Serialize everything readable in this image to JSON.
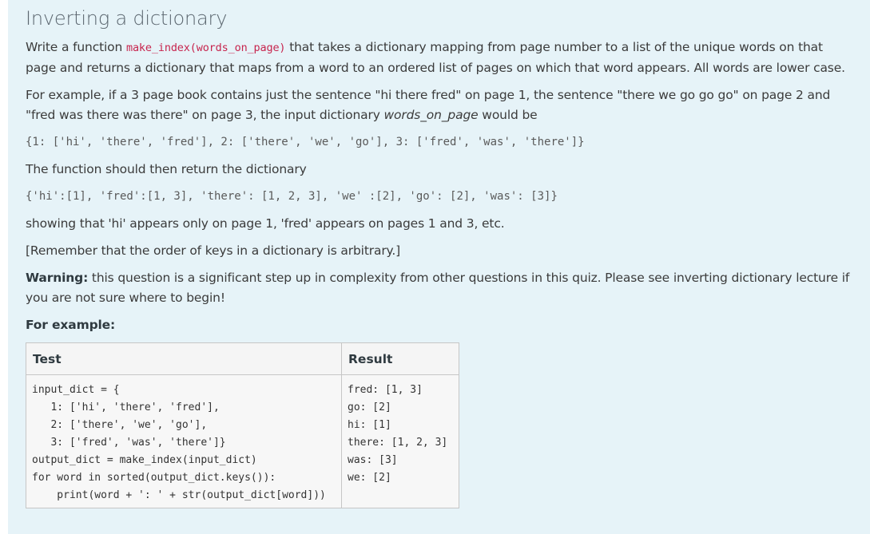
{
  "question": {
    "title": "Inverting a dictionary",
    "intro_before": "Write a function ",
    "function_signature": "make_index(words_on_page)",
    "intro_after": " that takes a dictionary mapping from page number to a list of the unique words on that page and returns a dictionary that maps from a word to an ordered list of pages on which that word appears. All words are lower case.",
    "example_text_before": "For example, if a 3 page book contains just the sentence \"hi there fred\" on page 1, the sentence \"there we go go go\" on page 2 and \"fred was there was there\" on page 3, the input dictionary ",
    "example_text_em": "words_on_page",
    "example_text_after": " would be",
    "input_dict_literal": "{1: ['hi', 'there', 'fred'], 2: ['there', 'we', 'go'], 3: ['fred', 'was', 'there']}",
    "return_text": "The function should then return the dictionary",
    "output_dict_literal": "{'hi':[1], 'fred':[1, 3], 'there': [1, 2, 3], 'we' :[2], 'go': [2], 'was': [3]}",
    "showing_text": "showing that 'hi' appears only on page 1, 'fred' appears on pages 1 and 3, etc.",
    "remember_text": "[Remember that the order of keys in a dictionary is arbitrary.]",
    "warning_label": "Warning:",
    "warning_text": " this question is a significant step up in complexity from other questions in this quiz. Please see inverting dictionary lecture if you are not sure where to begin!",
    "for_example_label": "For example:"
  },
  "examples_table": {
    "headers": {
      "test": "Test",
      "result": "Result"
    },
    "rows": [
      {
        "test": "input_dict = {\n   1: ['hi', 'there', 'fred'],\n   2: ['there', 'we', 'go'],\n   3: ['fred', 'was', 'there']}\noutput_dict = make_index(input_dict)\nfor word in sorted(output_dict.keys()):\n    print(word + ': ' + str(output_dict[word]))",
        "result": "fred: [1, 3]\ngo: [2]\nhi: [1]\nthere: [1, 2, 3]\nwas: [3]\nwe: [2]"
      }
    ]
  },
  "colors": {
    "panel_background": "#e6f3f8",
    "inline_code": "#c7254e"
  }
}
